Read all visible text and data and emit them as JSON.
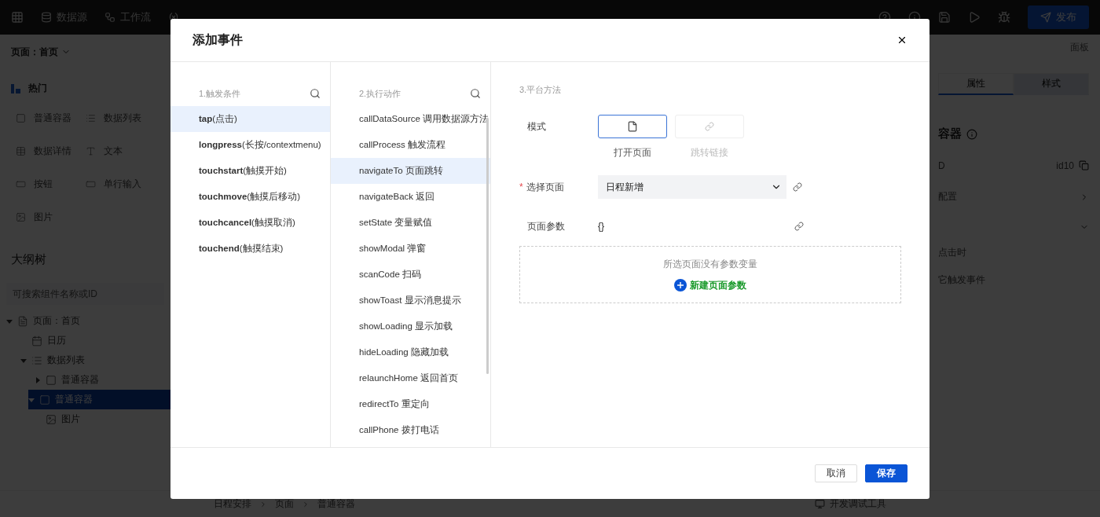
{
  "topbar": {
    "tools": [
      {
        "kind": "data",
        "label": "数据源"
      },
      {
        "kind": "flow",
        "label": "工作流"
      },
      {
        "kind": "var"
      }
    ],
    "publish": "发布"
  },
  "left_panel": {
    "page_select": "页面：首页",
    "hot_title": "热门",
    "components": [
      {
        "kind": "container",
        "label": "普通容器"
      },
      {
        "kind": "list",
        "label": "数据列表"
      },
      {
        "kind": "detail",
        "label": "数据详情"
      },
      {
        "kind": "text",
        "label": "文本"
      },
      {
        "kind": "button",
        "label": "按钮"
      },
      {
        "kind": "input",
        "label": "单行输入"
      },
      {
        "kind": "image",
        "label": "图片"
      }
    ],
    "outline_title": "大纲树",
    "search": {
      "placeholder": "可搜索组件名称或ID"
    },
    "tree": [
      {
        "kind": "page",
        "label": "页面：首页",
        "expanded": true,
        "selected": false,
        "children": [
          {
            "kind": "calendar",
            "label": "日历",
            "selected": false
          },
          {
            "kind": "list",
            "label": "数据列表",
            "expanded": true,
            "selected": false,
            "children": [
              {
                "kind": "container",
                "label": "普通容器",
                "expanded": false,
                "selected": false
              }
            ]
          },
          {
            "kind": "container",
            "label": "普通容器",
            "expanded": true,
            "selected": true,
            "children": [
              {
                "kind": "image",
                "label": "图片",
                "selected": false
              }
            ]
          }
        ]
      }
    ]
  },
  "right_panel": {
    "panel_label": "面板",
    "tabs": [
      {
        "label": "属性",
        "selected": true
      },
      {
        "label": "样式",
        "selected": false
      }
    ],
    "component_title": "容器",
    "id_label": "D",
    "id_value": "id10",
    "config_label": "配置",
    "events": [
      "点击时",
      "它触发事件"
    ]
  },
  "breadcrumb": [
    "日程安排",
    "页面",
    "普通容器"
  ],
  "debug_tool": "开发调试工具",
  "dialog": {
    "title": "添加事件",
    "triggers": {
      "heading": "1.触发条件",
      "items": [
        {
          "label": "**tap**(点击)",
          "selected": true
        },
        {
          "label": "**longpress**(长按/contextmenu)",
          "selected": false
        },
        {
          "label": "**touchstart**(触摸开始)",
          "selected": false
        },
        {
          "label": "**touchmove**(触摸后移动)",
          "selected": false
        },
        {
          "label": "**touchcancel**(触摸取消)",
          "selected": false
        },
        {
          "label": "**touchend**(触摸结束)",
          "selected": false
        }
      ]
    },
    "actions": {
      "heading": "2.执行动作",
      "items": [
        {
          "label": "callDataSource 调用数据源方法",
          "selected": false
        },
        {
          "label": "callProcess 触发流程",
          "selected": false
        },
        {
          "label": "navigateTo 页面跳转",
          "selected": true
        },
        {
          "label": "navigateBack 返回",
          "selected": false
        },
        {
          "label": "setState 变量赋值",
          "selected": false
        },
        {
          "label": "showModal 弹窗",
          "selected": false
        },
        {
          "label": "scanCode 扫码",
          "selected": false
        },
        {
          "label": "showToast 显示消息提示",
          "selected": false
        },
        {
          "label": "showLoading 显示加载",
          "selected": false
        },
        {
          "label": "hideLoading 隐藏加载",
          "selected": false
        },
        {
          "label": "relaunchHome 返回首页",
          "selected": false
        },
        {
          "label": "redirectTo 重定向",
          "selected": false
        },
        {
          "label": "callPhone 拨打电话",
          "selected": false
        }
      ]
    },
    "platform": {
      "heading": "3.平台方法",
      "mode_label": "模式",
      "modes": [
        {
          "kind": "page",
          "label": "打开页面",
          "selected": true
        },
        {
          "kind": "link",
          "label": "跳转链接",
          "selected": false
        }
      ],
      "page_label": "选择页面",
      "required_mark": "*",
      "page_value": "日程新增",
      "params_label": "页面参数",
      "params_value": "{}",
      "empty_text": "所选页面没有参数变量",
      "add_param": "新建页面参数"
    },
    "buttons": [
      {
        "kind": "secondary",
        "label": "取消"
      },
      {
        "kind": "primary",
        "label": "保存"
      }
    ]
  }
}
